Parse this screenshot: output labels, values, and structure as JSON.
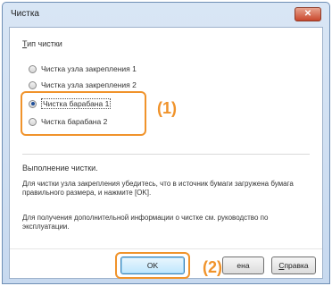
{
  "window": {
    "title": "Чистка",
    "close_glyph": "✕"
  },
  "cleaning_type": {
    "label_first": "Т",
    "label_rest": "ип чистки",
    "options": [
      {
        "label": "Чистка узла закрепления 1",
        "checked": false
      },
      {
        "label": "Чистка узла закрепления 2",
        "checked": false
      },
      {
        "label": "Чистка барабана 1",
        "checked": true
      },
      {
        "label": "Чистка барабана 2",
        "checked": false
      }
    ]
  },
  "annotations": {
    "marker1": "(1)",
    "marker2": "(2)",
    "color": "#f0932b"
  },
  "info": {
    "title": "Выполнение чистки.",
    "paragraph1": "Для чистки узла закрепления убедитесь, что в источник бумаги загружена бумага правильного размера, и нажмите [OK].",
    "paragraph2": "Для получения дополнительной информации о чистке см. руководство по эксплуатации."
  },
  "buttons": {
    "ok": "OK",
    "cancel_visible": "ена",
    "help_first": "С",
    "help_rest": "правка"
  }
}
